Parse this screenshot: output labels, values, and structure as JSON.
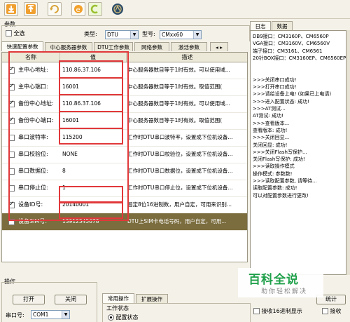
{
  "toolbar": {
    "buttons": [
      "download-icon",
      "upload-icon",
      "refresh-icon",
      "ie-icon",
      "connect-icon",
      "logo-icon"
    ]
  },
  "params": {
    "group_title": "参数",
    "select_all_label": "全选",
    "type_label": "类型:",
    "type_value": "DTU",
    "model_label": "型号:",
    "model_value": "CMxx60"
  },
  "tabs": [
    {
      "label": "快速配置参数",
      "active": true
    },
    {
      "label": "中心服务器参数",
      "active": false
    },
    {
      "label": "DTU工作参数",
      "active": false
    },
    {
      "label": "网络参数",
      "active": false
    },
    {
      "label": "激活参数",
      "active": false
    }
  ],
  "table": {
    "headers": [
      "名称",
      "值",
      "描述"
    ],
    "rows": [
      {
        "checked": true,
        "name": "主中心地址:",
        "value": "110.86.37.106",
        "desc": "中心服务器数目等于1时有效。可以使用域..."
      },
      {
        "checked": true,
        "name": "主中心端口:",
        "value": "16001",
        "desc": "中心服务器数目等于1时有效。取值范围("
      },
      {
        "checked": true,
        "name": "备份中心地址:",
        "value": "110.86.37.106",
        "desc": "中心服务器数目等于1时有效。可以使用域..."
      },
      {
        "checked": true,
        "name": "备份中心端口:",
        "value": "16001",
        "desc": "中心服务器数目等于1时有效。取值范围("
      },
      {
        "checked": false,
        "name": "串口波特率:",
        "value": "115200",
        "desc": "工作时DTU串口波特率，设置成下位机设备..."
      },
      {
        "checked": false,
        "name": "串口校验位:",
        "value": "NONE",
        "desc": "工作时DTU串口校验位，设置成下位机设备..."
      },
      {
        "checked": false,
        "name": "串口数据位:",
        "value": "8",
        "desc": "工作时DTU串口数据位，设置成下位机设备..."
      },
      {
        "checked": false,
        "name": "串口停止位:",
        "value": "1",
        "desc": "工作时DTU串口停止位，设置成下位机设备..."
      },
      {
        "checked": true,
        "name": "设备ID号:",
        "value": "20140001",
        "desc": "固定8位16进制数，用户自定，可用来识别..."
      },
      {
        "checked": false,
        "name": "设备SIM号:",
        "value": "13912345678",
        "desc": "DTU上SIM卡电话号码，用户自定，可用..."
      }
    ]
  },
  "right": {
    "tabs": [
      "日志",
      "数据"
    ],
    "log_lines": [
      "DB9接口：CM3160P、CM6560P",
      "VGA接口：CM3160V、CM6560V",
      "端子接口：CM3161、CM6561",
      "20针BOX接口：CM3160EP、CM6560EP",
      "",
      "",
      ">>>关闭串口成功!",
      ">>>打开串口成功!",
      ">>>请给设备上电! (如果已上电请)",
      ">>>进入配置状态: 成功!",
      ">>>AT测试...",
      "AT测试: 成功!",
      ">>>查看版本...",
      "查看版本: 成功!",
      ">>>关闭回显...",
      "关闭回显: 成功!",
      ">>>关闭Flash写保护...",
      "关闭Flash写保护: 成功!",
      ">>>读取操作模式",
      "操作模式: 参数数!",
      ">>>读取配置参数, 请等待...",
      "读取配置参数: 成功!",
      "可以对配置参数进行更改!"
    ]
  },
  "bottom": {
    "op_title": "操作",
    "open_label": "打开",
    "close_label": "关闭",
    "port_label": "串口号:",
    "port_value": "COM1",
    "tab_common": "常用操作",
    "tab_ext": "扩展操作",
    "work_status_label": "工作状态",
    "config_status_label": "配置状态",
    "recv_hex_label": "接收16进制显示",
    "recv_label": "接收",
    "stats_label": "统计"
  },
  "watermark": {
    "title": "百科全说",
    "subtitle": "助你轻松解决"
  },
  "colors": {
    "highlight": "#e1383a",
    "selected_row": "#7b6d3e",
    "brand_green": "#1fa04a"
  }
}
